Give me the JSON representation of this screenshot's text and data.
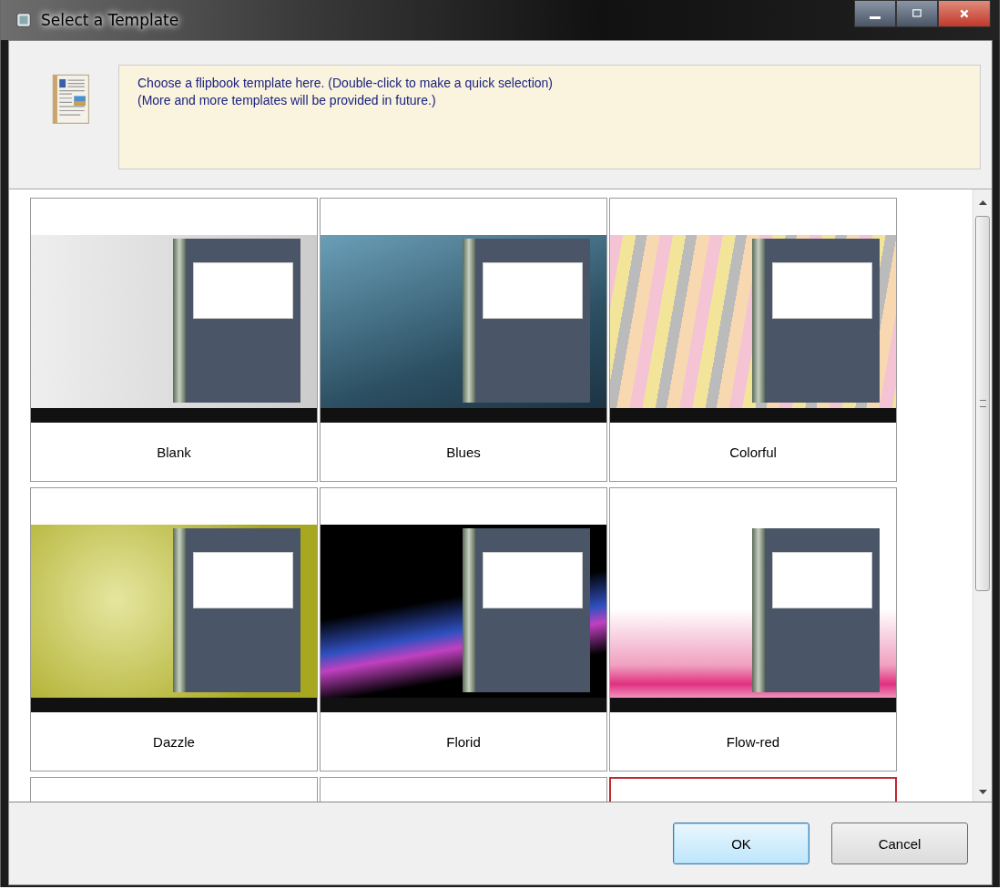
{
  "window": {
    "title": "Select a Template"
  },
  "info": {
    "lines": [
      "Choose a flipbook template here. (Double-click to make a quick selection)",
      "(More and more templates will be provided in future.)"
    ]
  },
  "templates": [
    {
      "name": "Blank",
      "selected": false
    },
    {
      "name": "Blues",
      "selected": false
    },
    {
      "name": "Colorful",
      "selected": false
    },
    {
      "name": "Dazzle",
      "selected": false
    },
    {
      "name": "Florid",
      "selected": false
    },
    {
      "name": "Flow-red",
      "selected": false
    },
    {
      "selected": false
    },
    {
      "selected": false
    },
    {
      "selected": true
    }
  ],
  "buttons": [
    {
      "label": "OK",
      "default": true
    },
    {
      "label": "Cancel",
      "default": false
    }
  ]
}
